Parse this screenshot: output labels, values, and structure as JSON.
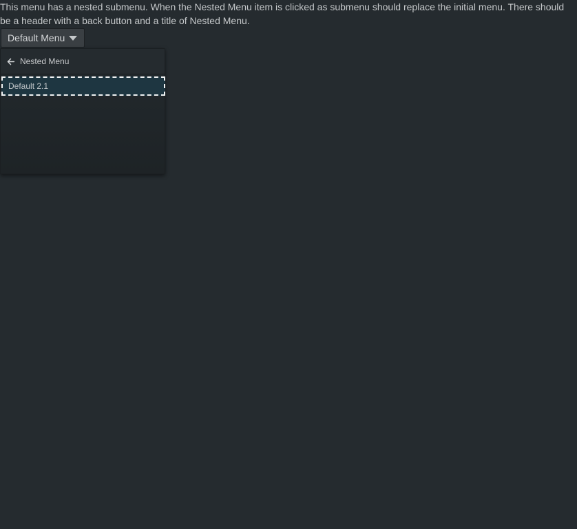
{
  "description": "This menu has a nested submenu. When the Nested Menu item is clicked as submenu should replace the initial menu. There should be a header with a back button and a title of Nested Menu.",
  "menu_trigger": {
    "label": "Default Menu",
    "icon": "caret-down-icon"
  },
  "submenu": {
    "back_icon": "arrow-left-icon",
    "title": "Nested Menu",
    "items": [
      {
        "label": "Default 2.1"
      }
    ]
  },
  "colors": {
    "background": "#252b2f",
    "focus_outline": "#f2f4f5",
    "active_item": "#1e3641"
  }
}
